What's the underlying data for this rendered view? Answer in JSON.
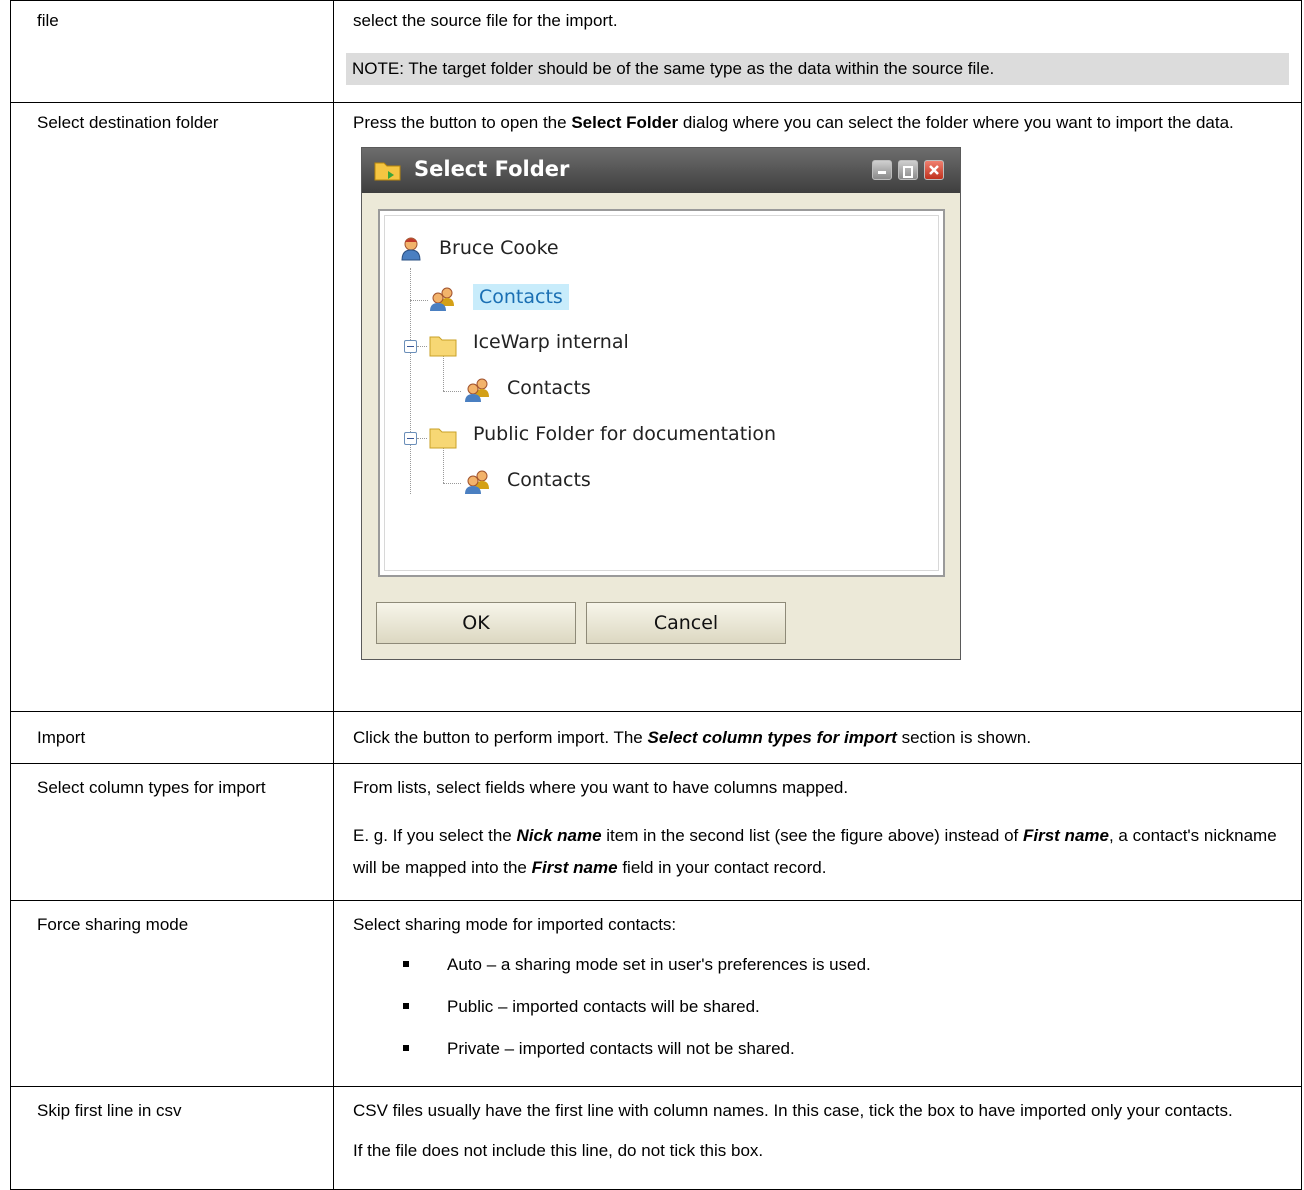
{
  "rows": [
    {
      "label": "file",
      "desc": "select the source file for the import.",
      "note": "NOTE: The target folder should be of the same type as the data within the source file."
    },
    {
      "label": "Select destination folder",
      "desc_pre": "Press the button to open the ",
      "desc_bold": "Select Folder",
      "desc_post": " dialog where you can select the folder where you want to import the data."
    },
    {
      "label": "Import",
      "desc_pre": "Click the button to perform import. The ",
      "desc_bi": "Select column types for import",
      "desc_post": " section is shown."
    },
    {
      "label": "Select column types for import",
      "p1": "From lists, select fields where you want to have columns mapped.",
      "p2_a": "E. g. If you select the ",
      "p2_b": "Nick name",
      "p2_c": " item in the second list (see the figure above) instead of ",
      "p2_d": "First name",
      "p2_e": ", a contact's nickname will be mapped into the ",
      "p2_f": "First name",
      "p2_g": " field in your contact record."
    },
    {
      "label": "Force sharing mode",
      "intro": "Select sharing mode for imported contacts:",
      "items": [
        "Auto – a sharing mode set in user's preferences is used.",
        "Public – imported contacts will be shared.",
        "Private – imported contacts will not be shared."
      ]
    },
    {
      "label": "Skip first line in csv",
      "p1": "CSV files usually have the first line with column names. In this case, tick the box to have imported only your contacts.",
      "p2": "If the file does not include this line, do not tick this box."
    }
  ],
  "dialog": {
    "title": "Select Folder",
    "tree": {
      "root": "Bruce Cooke",
      "contacts": "Contacts",
      "folder1": "IceWarp internal",
      "folder1_child": "Contacts",
      "folder2": "Public Folder for documentation",
      "folder2_child": "Contacts"
    },
    "ok_label": "OK",
    "cancel_label": "Cancel"
  }
}
